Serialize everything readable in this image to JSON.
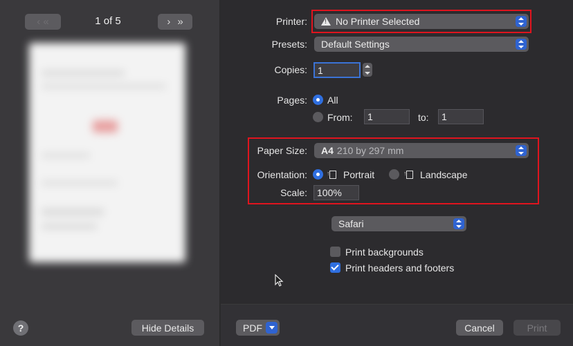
{
  "preview": {
    "page_indicator": "1 of 5",
    "next_glyph": "›",
    "last_glyph": "»",
    "help_label": "?",
    "hide_details_label": "Hide Details"
  },
  "printer": {
    "label": "Printer:",
    "value": "No Printer Selected"
  },
  "presets": {
    "label": "Presets:",
    "value": "Default Settings"
  },
  "copies": {
    "label": "Copies:",
    "value": "1"
  },
  "pages": {
    "label": "Pages:",
    "all_label": "All",
    "from_label": "From:",
    "from_value": "1",
    "to_label": "to:",
    "to_value": "1"
  },
  "paper_size": {
    "label": "Paper Size:",
    "name": "A4",
    "detail": "210 by 297 mm"
  },
  "orientation": {
    "label": "Orientation:",
    "portrait_label": "Portrait",
    "landscape_label": "Landscape"
  },
  "scale": {
    "label": "Scale:",
    "value": "100%"
  },
  "app_menu": {
    "value": "Safari"
  },
  "options": {
    "print_backgrounds": "Print backgrounds",
    "print_headers_footers": "Print headers and footers"
  },
  "bottom": {
    "pdf_label": "PDF",
    "cancel_label": "Cancel",
    "print_label": "Print"
  },
  "colors": {
    "accent": "#2f6fe0",
    "highlight": "#e0141e"
  }
}
